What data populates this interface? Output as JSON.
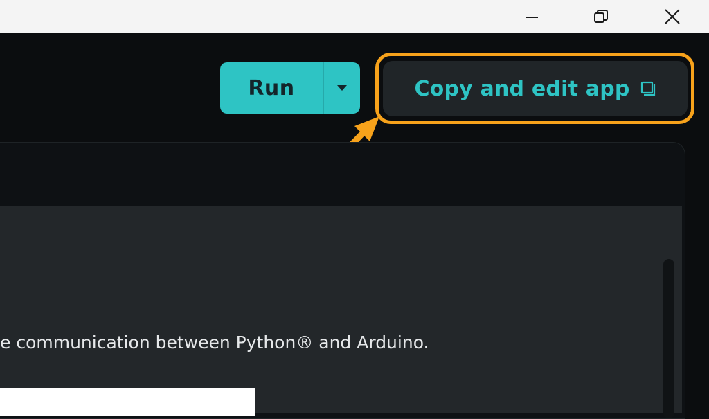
{
  "window_controls": {
    "minimize_icon": "minimize-icon",
    "restore_icon": "restore-icon",
    "close_icon": "close-icon"
  },
  "toolbar": {
    "run_label": "Run",
    "run_menu_icon": "caret-down-icon",
    "copy_label": "Copy and edit app",
    "copy_icon": "copy-icon"
  },
  "content": {
    "description": "e communication between Python® and Arduino."
  },
  "colors": {
    "accent_teal": "#2ec4c4",
    "highlight_orange": "#f7a21b",
    "background_dark": "#0b0d0f",
    "panel_gray": "#23272a"
  }
}
